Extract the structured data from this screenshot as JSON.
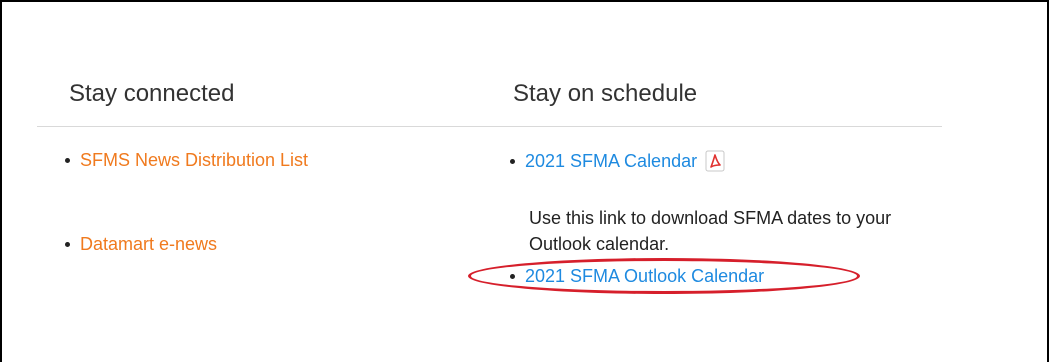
{
  "left_column": {
    "heading": "Stay connected",
    "links": [
      {
        "label": "SFMS News Distribution List"
      },
      {
        "label": "Datamart e-news"
      }
    ]
  },
  "right_column": {
    "heading": "Stay on schedule",
    "calendar_link": {
      "label": "2021 SFMA Calendar",
      "icon": "pdf-icon"
    },
    "description": "Use this link to download SFMA dates to your Outlook calendar.",
    "outlook_link": {
      "label": "2021 SFMA Outlook Calendar"
    }
  },
  "colors": {
    "orange_link": "#f07a1e",
    "blue_link": "#1e8ae0",
    "highlight": "#d61f2b"
  }
}
